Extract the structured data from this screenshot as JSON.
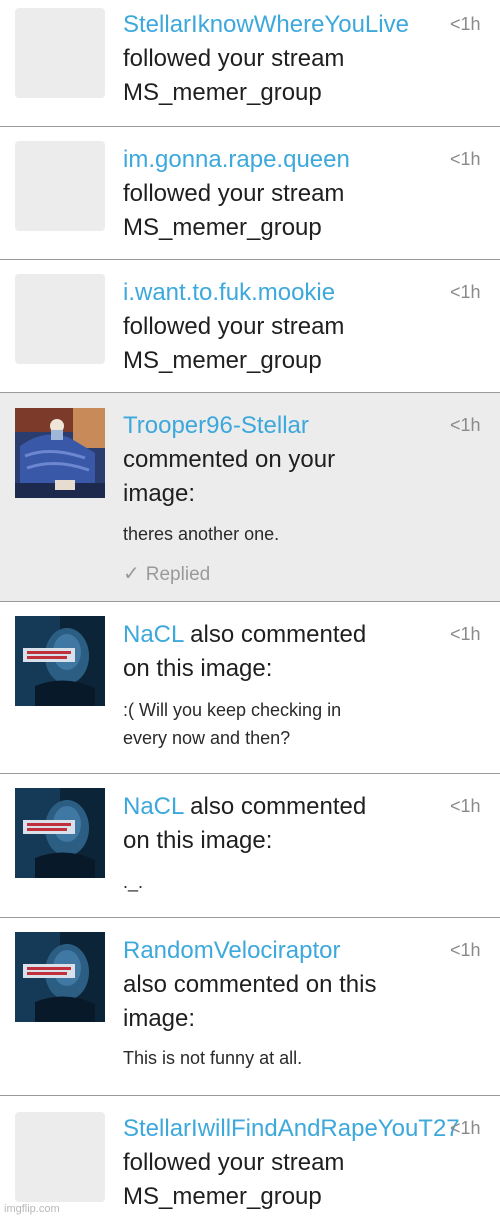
{
  "notifications": [
    {
      "username": "StellarIknowWhereYouLive",
      "action": "followed your stream",
      "target": "MS_memer_group",
      "time": "<1h",
      "avatar": "blank"
    },
    {
      "username": "im.gonna.rape.queen",
      "action": "followed your stream",
      "target": "MS_memer_group",
      "time": "<1h",
      "avatar": "blank"
    },
    {
      "username": "i.want.to.fuk.mookie",
      "action": "followed your stream",
      "target": "MS_memer_group",
      "time": "<1h",
      "avatar": "blank"
    },
    {
      "username": "Trooper96-Stellar",
      "action_line1": "commented on your",
      "action_line2": "image:",
      "comment": "theres another one.",
      "status": "Replied",
      "time": "<1h",
      "avatar": "bedroom-cartoon-image"
    },
    {
      "username": "NaCL",
      "action_line1": " also commented",
      "action_line2": "on this image:",
      "comment_line1": ":( Will you keep checking in",
      "comment_line2": "every now and then?",
      "time": "<1h",
      "avatar": "dark-portrait-meme-image"
    },
    {
      "username": "NaCL",
      "action_line1": " also commented",
      "action_line2": "on this image:",
      "comment": "._.",
      "time": "<1h",
      "avatar": "dark-portrait-meme-image"
    },
    {
      "username": "RandomVelociraptor",
      "action_line1": "also commented on this",
      "action_line2": "image:",
      "comment": "This is not funny at all.",
      "time": "<1h",
      "avatar": "dark-portrait-meme-image"
    },
    {
      "username": "StellarIwillFindAndRapeYouT27",
      "action": "followed your stream",
      "target": "MS_memer_group",
      "time": "<1h",
      "avatar": "blank"
    }
  ],
  "watermark": "imgflip.com",
  "colors": {
    "username": "#3ca8dc",
    "highlight_bg": "#ececec",
    "divider": "#9a9a9a"
  }
}
